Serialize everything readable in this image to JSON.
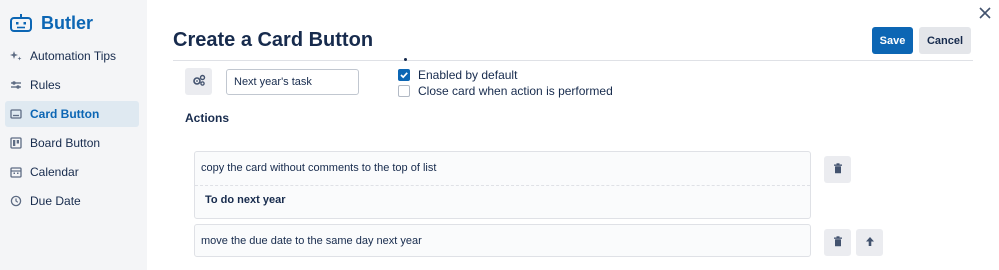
{
  "sidebar": {
    "brand": "Butler",
    "items": [
      {
        "label": "Automation Tips",
        "icon": "sparkle-icon"
      },
      {
        "label": "Rules",
        "icon": "sliders-icon"
      },
      {
        "label": "Card Button",
        "icon": "card-icon",
        "active": true
      },
      {
        "label": "Board Button",
        "icon": "board-icon"
      },
      {
        "label": "Calendar",
        "icon": "calendar-icon"
      },
      {
        "label": "Due Date",
        "icon": "clock-icon"
      }
    ]
  },
  "header": {
    "title": "Create a Card Button",
    "save_label": "Save",
    "cancel_label": "Cancel"
  },
  "button_settings": {
    "name_value": "Next year's task",
    "enabled_by_default": {
      "label": "Enabled by default",
      "checked": true
    },
    "close_card": {
      "label": "Close card when action is performed",
      "checked": false
    }
  },
  "actions": {
    "label": "Actions",
    "items": [
      {
        "text": "copy the card without comments to the top of list",
        "subtext": "To do next year"
      },
      {
        "text": "move the due date to the same day next year"
      }
    ]
  },
  "colors": {
    "accent": "#0c66b4",
    "sidebar_bg": "#f4f5f7",
    "active_item_bg": "#dfe9f1",
    "button_grey": "#ebecf0"
  }
}
